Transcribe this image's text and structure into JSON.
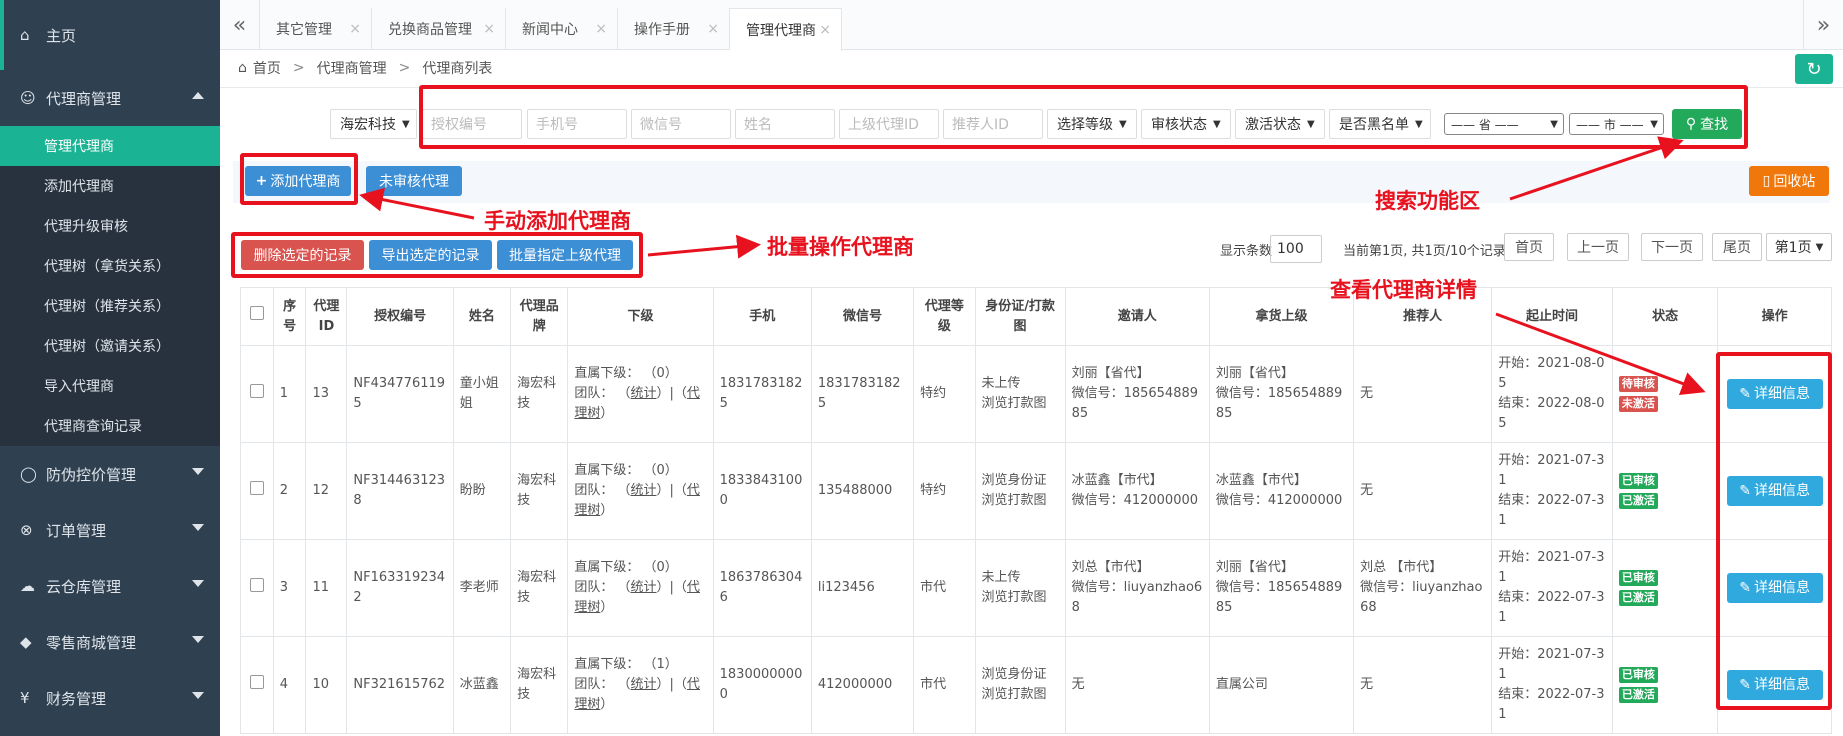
{
  "sidebar": {
    "home": "主页",
    "agent_mgmt": "代理商管理",
    "sub_items": [
      "管理代理商",
      "添加代理商",
      "代理升级审核",
      "代理树（拿货关系）",
      "代理树（推荐关系）",
      "代理树（邀请关系）",
      "导入代理商",
      "代理商查询记录"
    ],
    "groups": [
      "防伪控价管理",
      "订单管理",
      "云仓库管理",
      "零售商城管理",
      "财务管理"
    ]
  },
  "tabs": [
    "其它管理",
    "兑换商品管理",
    "新闻中心",
    "操作手册",
    "管理代理商"
  ],
  "breadcrumb": [
    "首页",
    "代理商管理",
    "代理商列表"
  ],
  "search": {
    "brand": "海宏科技",
    "placeholders": [
      "授权编号",
      "手机号",
      "微信号",
      "姓名",
      "上级代理ID",
      "推荐人ID"
    ],
    "selects": [
      "选择等级",
      "审核状态",
      "激活状态",
      "是否黑名单"
    ],
    "province": "—— 省 ——",
    "city": "—— 市 ——",
    "search_btn": "查找"
  },
  "toolbar": {
    "add": "添加代理商",
    "unreviewed": "未审核代理",
    "recycle": "回收站",
    "delete_sel": "删除选定的记录",
    "export_sel": "导出选定的记录",
    "batch_assign": "批量指定上级代理"
  },
  "paging": {
    "show_label": "显示条数",
    "page_size": "100",
    "status": "当前第1页, 共1页/10个记录",
    "first": "首页",
    "prev": "上一页",
    "next": "下一页",
    "last": "尾页",
    "current": "第1页"
  },
  "annotations": {
    "search_area": "搜索功能区",
    "manual_add": "手动添加代理商",
    "batch_ops": "批量操作代理商",
    "view_detail": "查看代理商详情"
  },
  "table": {
    "headers": [
      "",
      "序号",
      "代理ID",
      "授权编号",
      "姓名",
      "代理品牌",
      "下级",
      "手机",
      "微信号",
      "代理等级",
      "身份证/打款图",
      "邀请人",
      "拿货上级",
      "推荐人",
      "起止时间",
      "状态",
      "操作"
    ],
    "detail_btn": "详细信息",
    "sub_prefix": "直属下级：",
    "team_label": "团队：",
    "stat": "统计",
    "tree": "代理树",
    "rows": [
      {
        "seq": "1",
        "id": "13",
        "auth": "NF4347761195",
        "name": "童小姐姐",
        "brand": "海宏科技",
        "subs": "（0）",
        "phone": "18317831825",
        "wechat": "18317831825",
        "level": "特约",
        "idimg": [
          "未上传",
          "浏览打款图"
        ],
        "inviter": [
          "刘丽【省代】",
          "微信号：18565488985"
        ],
        "upper": [
          "刘丽【省代】",
          "微信号：18565488985"
        ],
        "referrer": [
          "无",
          ""
        ],
        "start": "开始：2021-08-05",
        "end": "结束：2022-08-05",
        "s1": "待审核",
        "s2": "未激活",
        "s1c": "red",
        "s2c": "red"
      },
      {
        "seq": "2",
        "id": "12",
        "auth": "NF3144631238",
        "name": "盼盼",
        "brand": "海宏科技",
        "subs": "（0）",
        "phone": "18338431000",
        "wechat": "135488000",
        "level": "特约",
        "idimg": [
          "浏览身份证",
          "浏览打款图"
        ],
        "inviter": [
          "冰蓝鑫【市代】",
          "微信号：412000000"
        ],
        "upper": [
          "冰蓝鑫【市代】",
          "微信号：412000000"
        ],
        "referrer": [
          "无",
          ""
        ],
        "start": "开始：2021-07-31",
        "end": "结束：2022-07-31",
        "s1": "已审核",
        "s2": "已激活",
        "s1c": "green",
        "s2c": "green"
      },
      {
        "seq": "3",
        "id": "11",
        "auth": "NF1633192342",
        "name": "李老师",
        "brand": "海宏科技",
        "subs": "（0）",
        "phone": "18637863046",
        "wechat": "li123456",
        "level": "市代",
        "idimg": [
          "未上传",
          "浏览打款图"
        ],
        "inviter": [
          "刘总【市代】",
          "微信号：liuyanzhao68"
        ],
        "upper": [
          "刘丽【省代】",
          "微信号：18565488985"
        ],
        "referrer": [
          "刘总 【市代】",
          "微信号：liuyanzhao68"
        ],
        "start": "开始：2021-07-31",
        "end": "结束：2022-07-31",
        "s1": "已审核",
        "s2": "已激活",
        "s1c": "green",
        "s2c": "green"
      },
      {
        "seq": "4",
        "id": "10",
        "auth": "NF321615762",
        "name": "冰蓝鑫",
        "brand": "海宏科技",
        "subs": "（1）",
        "phone": "18300000000",
        "wechat": "412000000",
        "level": "市代",
        "idimg": [
          "浏览身份证",
          "浏览打款图"
        ],
        "inviter": [
          "无",
          ""
        ],
        "upper": [
          "直属公司",
          ""
        ],
        "referrer": [
          "无",
          ""
        ],
        "start": "开始：2021-07-31",
        "end": "结束：2022-07-31",
        "s1": "已审核",
        "s2": "已激活",
        "s1c": "green",
        "s2c": "green"
      }
    ]
  }
}
